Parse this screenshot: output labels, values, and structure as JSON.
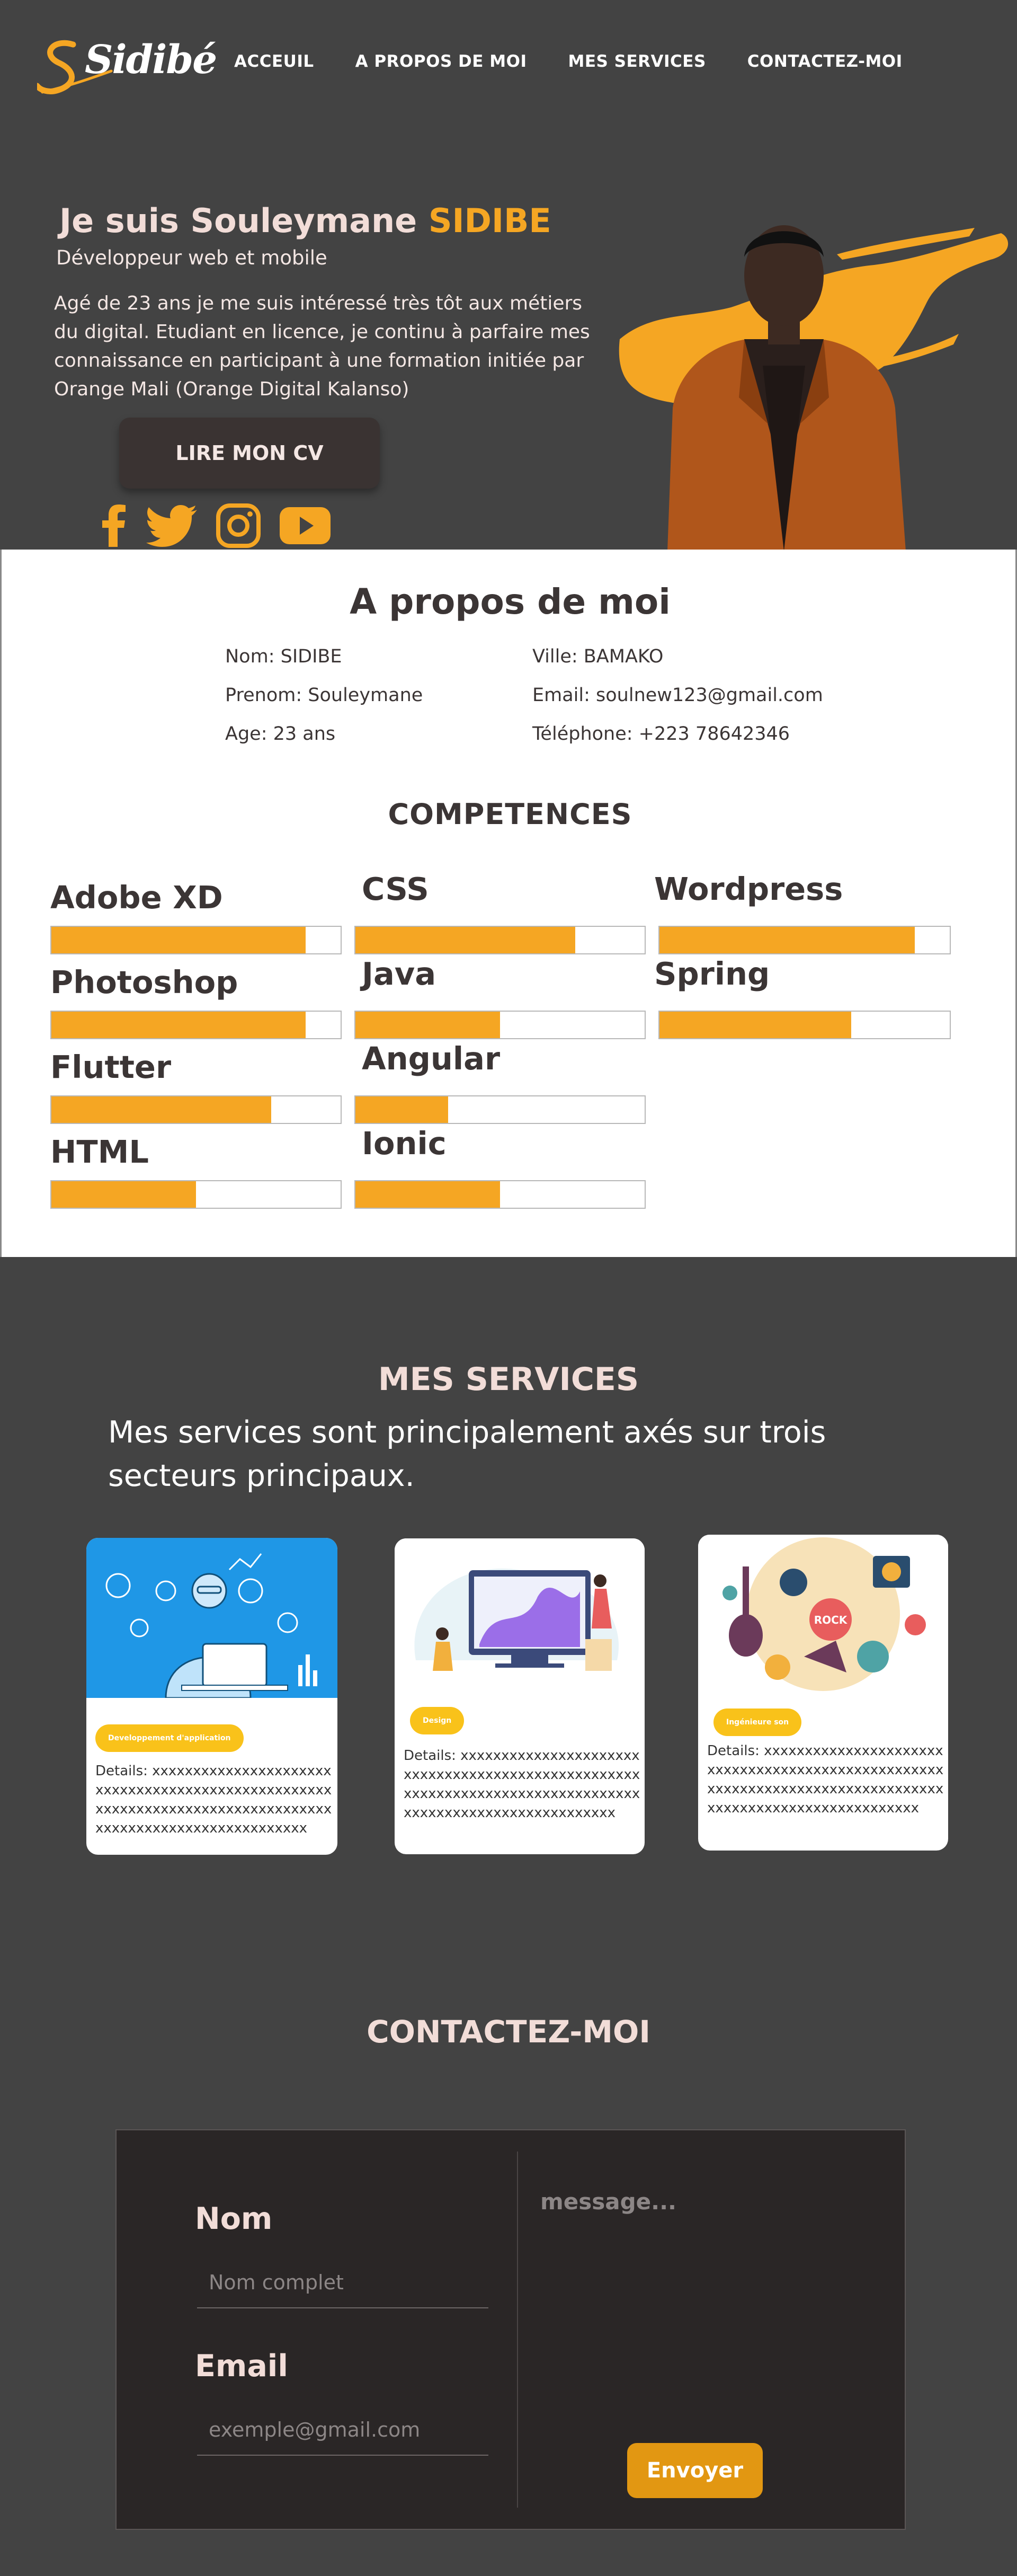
{
  "brand": {
    "name": "Sidibé",
    "initial": "S"
  },
  "nav": {
    "items": [
      {
        "label": "ACCEUIL"
      },
      {
        "label": "A PROPOS DE MOI"
      },
      {
        "label": "MES SERVICES"
      },
      {
        "label": "CONTACTEZ-MOI"
      }
    ]
  },
  "hero": {
    "title_prefix": "Je suis Souleymane ",
    "title_highlight": "SIDIBE",
    "subtitle": "Développeur web et mobile",
    "description": "Agé de 23 ans je me suis intéressé très tôt aux métiers du digital. Etudiant en licence, je continu à parfaire mes connaissance en participant à une formation initiée par Orange Mali (Orange Digital Kalanso)",
    "cv_button": "LIRE MON CV",
    "socials": [
      "facebook-icon",
      "twitter-icon",
      "instagram-icon",
      "youtube-icon"
    ]
  },
  "about": {
    "title": "A propos de moi",
    "nom": "Nom: SIDIBE",
    "prenom": "Prenom: Souleymane",
    "age": "Age: 23 ans",
    "ville": "Ville: BAMAKO",
    "email": "Email: soulnew123@gmail.com",
    "telephone": "Téléphone: +223 78642346"
  },
  "competences": {
    "title": "COMPETENCES",
    "skills": [
      {
        "name": "Adobe XD",
        "level": 0.88
      },
      {
        "name": "Photoshop",
        "level": 0.88
      },
      {
        "name": "Flutter",
        "level": 0.76
      },
      {
        "name": "HTML",
        "level": 0.5
      },
      {
        "name": "CSS",
        "level": 0.76
      },
      {
        "name": "Java",
        "level": 0.5
      },
      {
        "name": "Angular",
        "level": 0.32
      },
      {
        "name": "Ionic",
        "level": 0.5
      },
      {
        "name": "Wordpress",
        "level": 0.88
      },
      {
        "name": "Spring",
        "level": 0.66
      }
    ]
  },
  "services": {
    "title": "MES SERVICES",
    "intro": "Mes services sont principalement axés sur trois secteurs principaux.",
    "cards": [
      {
        "badge": "Developpement d'application",
        "details": "Details: xxxxxxxxxxxxxxxxxxxxxxxxxxxxxxxxxxxxxxxxxxxxxxxxxxxxxxxxxxxxxxxxxxxxxxxxxxxxxxxxxxxxxxxxxxxxxxxxxxxxxxxxxx"
      },
      {
        "badge": "Design",
        "details": "Details: xxxxxxxxxxxxxxxxxxxxxxxxxxxxxxxxxxxxxxxxxxxxxxxxxxxxxxxxxxxxxxxxxxxxxxxxxxxxxxxxxxxxxxxxxxxxxxxxxxxxxxxxxx"
      },
      {
        "badge": "Ingénieure son",
        "details": "Details: xxxxxxxxxxxxxxxxxxxxxxxxxxxxxxxxxxxxxxxxxxxxxxxxxxxxxxxxxxxxxxxxxxxxxxxxxxxxxxxxxxxxxxxxxxxxxxxxxxxxxxxxxx"
      }
    ]
  },
  "contact": {
    "title": "CONTACTEZ-MOI",
    "name_label": "Nom",
    "name_placeholder": "Nom complet",
    "email_label": "Email",
    "email_placeholder": "exemple@gmail.com",
    "message_placeholder": "message...",
    "send_button": "Envoyer"
  },
  "colors": {
    "accent": "#f5a623",
    "dark": "#434343",
    "button": "#e29712"
  }
}
